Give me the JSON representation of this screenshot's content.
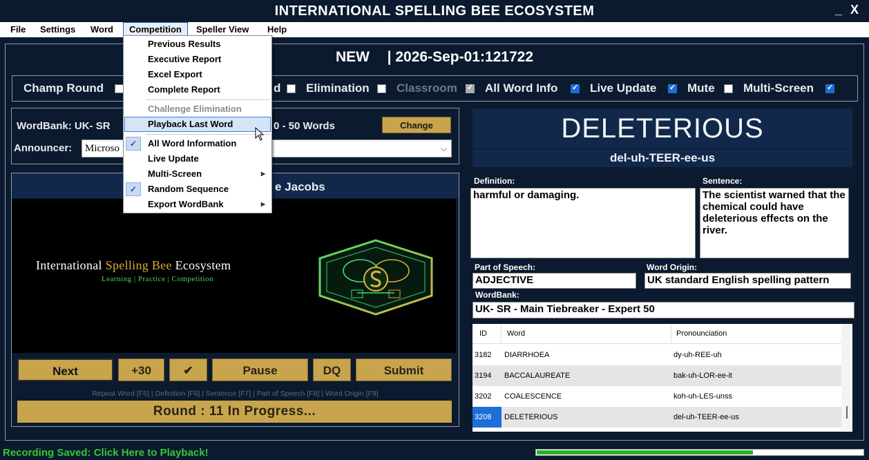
{
  "window": {
    "title": "INTERNATIONAL SPELLING BEE ECOSYSTEM",
    "minimize": "_",
    "close": "X"
  },
  "menubar": [
    "File",
    "Settings",
    "Word",
    "Competition",
    "Speller View",
    "Help"
  ],
  "competition_menu": {
    "items": [
      {
        "label": "Previous Results"
      },
      {
        "label": "Executive Report"
      },
      {
        "label": "Excel Export"
      },
      {
        "label": "Complete Report"
      },
      {
        "label": "Challenge Elimination",
        "disabled": true
      },
      {
        "label": "Playback Last Word",
        "highlighted": true
      },
      {
        "label": "All Word Information",
        "checked": true
      },
      {
        "label": "Live Update"
      },
      {
        "label": "Multi-Screen",
        "submenu": true
      },
      {
        "label": "Random Sequence",
        "checked": true
      },
      {
        "label": "Export WordBank",
        "submenu": true
      }
    ],
    "check_mark": "✓",
    "submenu_arrow": "▶"
  },
  "session": {
    "status": "NEW",
    "separator": "|",
    "id": "2026-Sep-01:121722"
  },
  "options": [
    {
      "label": "Champ Round",
      "checked": false
    },
    {
      "label": "d",
      "checked": false
    },
    {
      "label": "Elimination",
      "checked": false
    },
    {
      "label": "Classroom",
      "checked": true,
      "disabled": true
    },
    {
      "label": "All Word Info",
      "checked": true
    },
    {
      "label": "Live Update",
      "checked": true
    },
    {
      "label": "Mute",
      "checked": false
    },
    {
      "label": "Multi-Screen",
      "checked": true
    }
  ],
  "wordbank_panel": {
    "wordbank_label": "WordBank: UK- SR",
    "words_label": "0 - 50 Words",
    "change_button": "Change",
    "announcer_label": "Announcer:",
    "announcer_value": "Microso",
    "dropdown_arrow": "⌵"
  },
  "speller": {
    "name_fragment": "e Jacobs"
  },
  "banner": {
    "title_part1": "International ",
    "title_gold": "Spelling Bee",
    "title_part2": " Ecosystem",
    "subtitle": "Learning | Practice | Competition"
  },
  "controls": {
    "next": "Next",
    "plus30": "+30",
    "check": "✔",
    "pause": "Pause",
    "dq": "DQ",
    "submit": "Submit"
  },
  "shortcuts": "Repeat Word [F5] | Definition [F6] | Sentence [F7] | Part of Speech [F8] | Word Origin [F9]",
  "round_status": "Round :  11 In Progress...",
  "word": {
    "word": "DELETERIOUS",
    "pronunciation": "del-uh-TEER-ee-us",
    "definition_label": "Definition:",
    "definition": "harmful or damaging.",
    "sentence_label": "Sentence:",
    "sentence": "The scientist warned that the chemical could have deleterious effects on the river.",
    "pos_label": "Part of Speech:",
    "pos": "ADJECTIVE",
    "origin_label": "Word Origin:",
    "origin": "UK standard English spelling pattern",
    "wordbank_label": "WordBank:",
    "wordbank": "UK- SR - Main Tiebreaker - Expert 50"
  },
  "table": {
    "headers": [
      "ID",
      "Word",
      "Pronounciation"
    ],
    "rows": [
      {
        "id": "3182",
        "word": "DIARRHOEA",
        "pron": "dy-uh-REE-uh"
      },
      {
        "id": "3194",
        "word": "BACCALAUREATE",
        "pron": "bak-uh-LOR-ee-it"
      },
      {
        "id": "3202",
        "word": "COALESCENCE",
        "pron": "koh-uh-LES-unss"
      },
      {
        "id": "3208",
        "word": "DELETERIOUS",
        "pron": "del-uh-TEER-ee-us",
        "selected": true
      }
    ]
  },
  "footer": {
    "recording": "Recording Saved: Click Here to Playback!",
    "progress": 0.66
  },
  "colors": {
    "background": "#0b1a2e",
    "gold": "#c8a44c",
    "panel": "#11284a",
    "accent": "#1c6ed8",
    "status_green": "#36c832"
  }
}
